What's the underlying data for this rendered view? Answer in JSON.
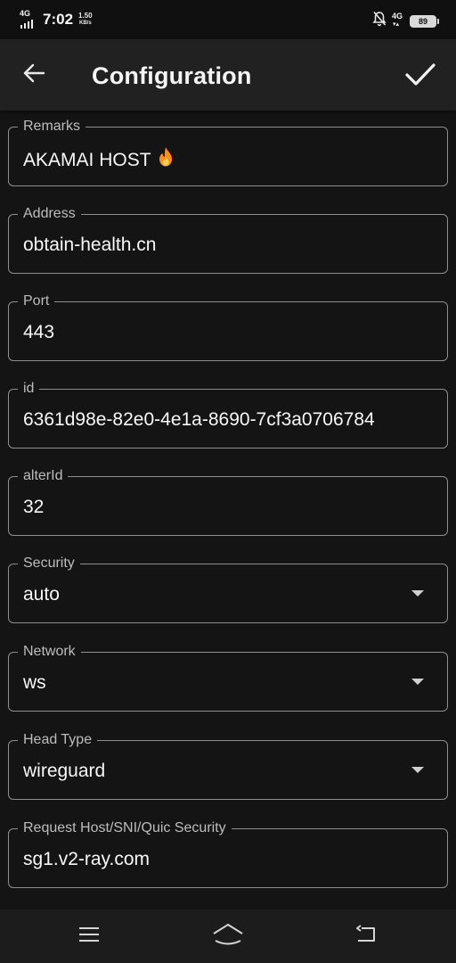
{
  "status_bar": {
    "network_left": "4G",
    "time": "7:02",
    "speed_value": "1.50",
    "speed_unit": "KB/s",
    "network_right": "4G",
    "battery_level": "89"
  },
  "app_bar": {
    "title": "Configuration",
    "back_icon": "arrow-left-icon",
    "confirm_icon": "check-icon"
  },
  "form": {
    "remarks": {
      "label": "Remarks",
      "value": "AKAMAI HOST"
    },
    "address": {
      "label": "Address",
      "value": "obtain-health.cn"
    },
    "port": {
      "label": "Port",
      "value": "443"
    },
    "id": {
      "label": "id",
      "value": "6361d98e-82e0-4e1a-8690-7cf3a0706784"
    },
    "alter_id": {
      "label": "alterId",
      "value": "32"
    },
    "security": {
      "label": "Security",
      "value": "auto"
    },
    "network": {
      "label": "Network",
      "value": "ws"
    },
    "head_type": {
      "label": "Head Type",
      "value": "wireguard"
    },
    "request_host": {
      "label": "Request Host/SNI/Quic Security",
      "value": "sg1.v2-ray.com"
    }
  },
  "nav_bar": {
    "menu_icon": "menu-icon",
    "home_icon": "home-icon",
    "back_icon": "back-icon"
  },
  "colors": {
    "background": "#141414",
    "app_bar": "#212121",
    "field_border": "#8e8e8e",
    "label": "#bdbdbd",
    "text": "#f7f7f7",
    "flame": "#ff8c1a"
  }
}
